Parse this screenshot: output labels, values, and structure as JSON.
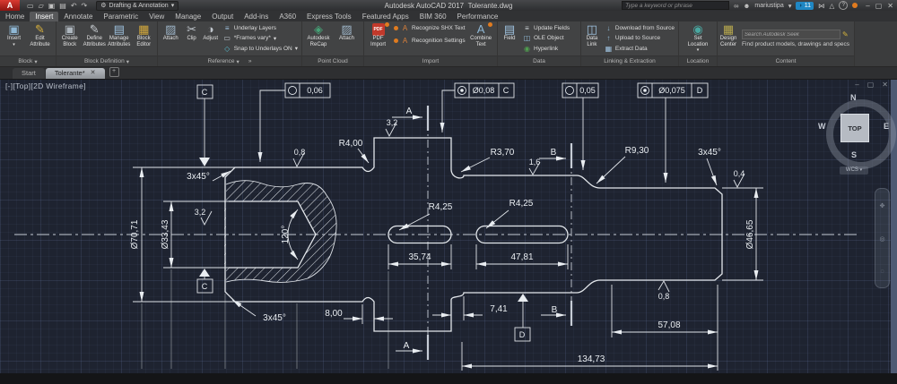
{
  "titlebar": {
    "workspace": "Drafting & Annotation",
    "title_app": "Autodesk AutoCAD 2017",
    "title_doc": "Tolerante.dwg",
    "search_placeholder": "Type a keyword or phrase",
    "user": "mariustipa",
    "badge_count": "11",
    "qat": [
      {
        "name": "new",
        "glyph": "▭"
      },
      {
        "name": "open",
        "glyph": "▱"
      },
      {
        "name": "save",
        "glyph": "▣"
      },
      {
        "name": "plot",
        "glyph": "▤"
      },
      {
        "name": "undo",
        "glyph": "↶"
      },
      {
        "name": "redo",
        "glyph": "↷"
      }
    ]
  },
  "ui": {
    "caret": "▾",
    "gear": "⚙",
    "binoculars": "∞",
    "person": "☻",
    "chat": "◗",
    "help": "?",
    "minimize": "–",
    "restore": "▢",
    "close": "✕",
    "plus": "+",
    "launcher": "»",
    "misc1": "⋈",
    "misc2": "△",
    "search_icon_color": "#d6b33a"
  },
  "ribbon": {
    "tabs": [
      {
        "label": "Home"
      },
      {
        "label": "Insert",
        "active": true
      },
      {
        "label": "Annotate"
      },
      {
        "label": "Parametric"
      },
      {
        "label": "View"
      },
      {
        "label": "Manage"
      },
      {
        "label": "Output"
      },
      {
        "label": "Add-ins"
      },
      {
        "label": "A360"
      },
      {
        "label": "Express Tools"
      },
      {
        "label": "Featured Apps"
      },
      {
        "label": "BIM 360"
      },
      {
        "label": "Performance"
      }
    ],
    "panels": [
      {
        "label": "Block",
        "menu": true,
        "items": [
          {
            "label": "Insert",
            "glyph": "▣",
            "color": "#8fb7d4"
          },
          {
            "label": "Edit Attribute",
            "glyph": "✎",
            "color": "#d9b23c"
          }
        ]
      },
      {
        "label": "Block Definition",
        "menu": true,
        "items": [
          {
            "label": "Create Block",
            "glyph": "▣",
            "color": "#aeb6be"
          },
          {
            "label": "Define Attributes",
            "glyph": "✎",
            "color": "#c8cdd2"
          },
          {
            "label": "Manage Attributes",
            "glyph": "▤",
            "color": "#9fc3e0"
          },
          {
            "label": "Block Editor",
            "glyph": "▦",
            "color": "#d4a93c"
          }
        ]
      },
      {
        "label": "Reference",
        "menu": true,
        "items": [
          {
            "label": "Attach",
            "glyph": "▨",
            "color": "#9fb6c9"
          },
          {
            "label": "Clip",
            "glyph": "✂",
            "color": "#c0c6cc"
          },
          {
            "label": "Adjust",
            "glyph": "◑",
            "color": "#c0c6cc"
          }
        ],
        "rows": [
          {
            "label": "Underlay Layers",
            "glyph": "≡",
            "color": "#9fc3e0"
          },
          {
            "label": "*Frames vary*",
            "glyph": "▭",
            "color": "#c0c6cc",
            "menu": true
          },
          {
            "label": "Snap to Underlays ON",
            "glyph": "◇",
            "color": "#58b7c9",
            "menu": true
          }
        ]
      },
      {
        "label": "Point Cloud",
        "items": [
          {
            "label": "Autodesk ReCap",
            "glyph": "◈",
            "color": "#46a176"
          },
          {
            "label": "Attach",
            "glyph": "▨",
            "color": "#9fb6c9"
          }
        ]
      },
      {
        "label": "Import",
        "items": [
          {
            "label": "PDF Import",
            "pdf": "PDF",
            "dot": true
          }
        ],
        "rows": [
          {
            "label": "Recognize SHX Text",
            "glyph": "A",
            "color": "#d87f3a",
            "dot": true
          },
          {
            "label": "Recognition Settings",
            "glyph": "A",
            "color": "#d87f3a",
            "dot": true
          }
        ],
        "item2": {
          "label": "Combine Text",
          "glyph": "A",
          "color": "#8fb7d4",
          "dot": true
        }
      },
      {
        "label": "Data",
        "items": [
          {
            "label": "Field",
            "glyph": "▤",
            "color": "#9fc3e0"
          }
        ],
        "rows": [
          {
            "label": "Update Fields",
            "glyph": "≡",
            "color": "#cfd4d9"
          },
          {
            "label": "OLE Object",
            "glyph": "◫",
            "color": "#8fb7d4"
          },
          {
            "label": "Hyperlink",
            "glyph": "◉",
            "color": "#4f9e4f"
          }
        ]
      },
      {
        "label": "Linking & Extraction",
        "items": [
          {
            "label": "Data Link",
            "glyph": "◫",
            "color": "#9fc3e0"
          }
        ],
        "rows": [
          {
            "label": "Download from Source",
            "glyph": "↓",
            "color": "#8fb7d4"
          },
          {
            "label": "Upload to Source",
            "glyph": "↑",
            "color": "#8fb7d4"
          },
          {
            "label": "Extract Data",
            "glyph": "▦",
            "color": "#9fc3e0"
          }
        ]
      },
      {
        "label": "Location",
        "items": [
          {
            "label": "Set Location",
            "glyph": "◉",
            "color": "#49a7a0",
            "menu": true
          }
        ]
      },
      {
        "label": "Content",
        "items": [
          {
            "label": "Design Center",
            "glyph": "▦",
            "color": "#b8a94e"
          }
        ],
        "search_placeholder": "Search Autodesk Seek",
        "caption": "Find product models, drawings and specs"
      }
    ]
  },
  "file_tabs": {
    "start": "Start",
    "active": "Tolerante*"
  },
  "viewport": {
    "controls": "[-]",
    "view": "[Top]",
    "style": "[2D Wireframe]"
  },
  "viewcube": {
    "n": "N",
    "e": "E",
    "s": "S",
    "w": "W",
    "top": "TOP",
    "wcs": "WCS"
  },
  "drawing": {
    "dims": {
      "dia_outer": "Ø70,71",
      "dia_bore": "Ø33,43",
      "dia_right": "Ø46,65",
      "len_slot1": "35,74",
      "len_slot2": "47,81",
      "groove1": "8,00",
      "groove2": "7,41",
      "len_right": "57,08",
      "len_total": "134,73",
      "angle_bore": "120°"
    },
    "radii": {
      "r1": "R4,00",
      "r2": "R3,70",
      "r3": "R9,30",
      "r4": "R4,25",
      "r5": "R4,25"
    },
    "chamfers": {
      "c1": "3x45°",
      "c2": "3x45°",
      "c3": "3x45°"
    },
    "finish": {
      "f1": "0,8",
      "f2": "3,2",
      "f3": "3,2",
      "f4": "1,6",
      "f5": "0,4",
      "f6": "0,8"
    },
    "sections": {
      "a": "A",
      "b": "B"
    },
    "datums": {
      "c": "C",
      "d": "D"
    },
    "fcf": [
      {
        "symbol": "circularity",
        "value": "0,06"
      },
      {
        "symbol": "concentricity",
        "value": "Ø0,08",
        "datum": "C"
      },
      {
        "symbol": "circularity",
        "value": "0,05"
      },
      {
        "symbol": "concentricity",
        "value": "Ø0,075",
        "datum": "D"
      }
    ]
  }
}
